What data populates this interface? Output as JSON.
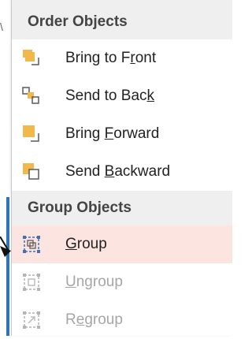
{
  "colors": {
    "icon_fill": "#f2b84b",
    "icon_stroke": "#5a5a5a",
    "group_icon": "#3f6fb5",
    "disabled_icon": "#b4b4b4",
    "selected_bg": "#fce4e0",
    "header_bg": "#efefef",
    "accent_line": "#2e75b6"
  },
  "menu": {
    "order_header": "Order Objects",
    "order_items": [
      {
        "pre": "Bring to F",
        "key": "r",
        "post": "ont",
        "icon": "bring-to-front-icon"
      },
      {
        "pre": "Send to Bac",
        "key": "k",
        "post": "",
        "icon": "send-to-back-icon"
      },
      {
        "pre": "Bring ",
        "key": "F",
        "post": "orward",
        "icon": "bring-forward-icon"
      },
      {
        "pre": "Send ",
        "key": "B",
        "post": "ackward",
        "icon": "send-backward-icon"
      }
    ],
    "group_header": "Group Objects",
    "group_items": [
      {
        "pre": "",
        "key": "G",
        "post": "roup",
        "icon": "group-icon",
        "state": "selected"
      },
      {
        "pre": "",
        "key": "U",
        "post": "ngroup",
        "icon": "ungroup-icon",
        "state": "disabled"
      },
      {
        "pre": "R",
        "key": "e",
        "post": "group",
        "icon": "regroup-icon",
        "state": "disabled"
      }
    ]
  }
}
